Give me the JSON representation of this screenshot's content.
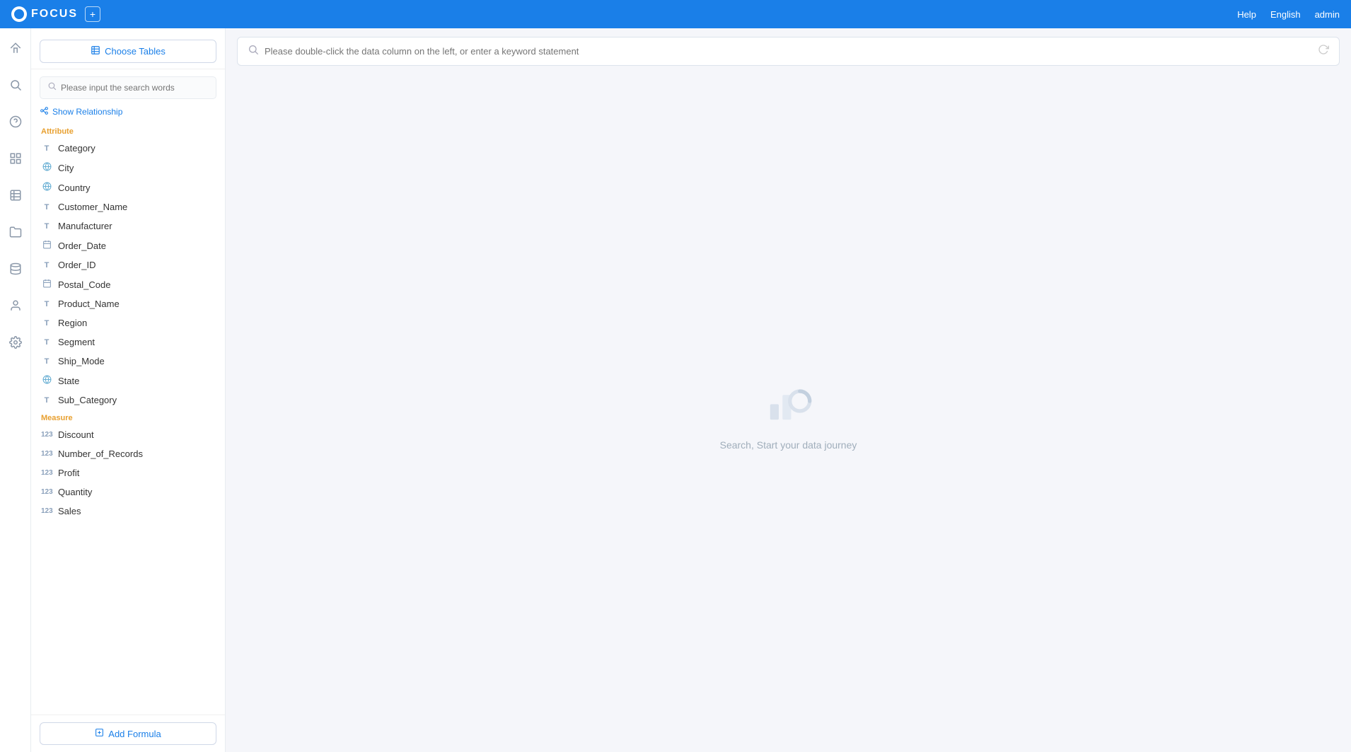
{
  "topnav": {
    "logo_text": "FOCUS",
    "help_label": "Help",
    "language_label": "English",
    "user_label": "admin"
  },
  "sidebar": {
    "choose_tables_label": "Choose Tables",
    "search_placeholder": "Please input the search words",
    "show_relationship_label": "Show Relationship",
    "attribute_section_label": "Attribute",
    "measure_section_label": "Measure",
    "add_formula_label": "Add Formula",
    "attribute_fields": [
      {
        "name": "Category",
        "type": "text"
      },
      {
        "name": "City",
        "type": "geo"
      },
      {
        "name": "Country",
        "type": "geo"
      },
      {
        "name": "Customer_Name",
        "type": "text"
      },
      {
        "name": "Manufacturer",
        "type": "text"
      },
      {
        "name": "Order_Date",
        "type": "date"
      },
      {
        "name": "Order_ID",
        "type": "text"
      },
      {
        "name": "Postal_Code",
        "type": "date"
      },
      {
        "name": "Product_Name",
        "type": "text"
      },
      {
        "name": "Region",
        "type": "text"
      },
      {
        "name": "Segment",
        "type": "text"
      },
      {
        "name": "Ship_Mode",
        "type": "text"
      },
      {
        "name": "State",
        "type": "geo"
      },
      {
        "name": "Sub_Category",
        "type": "text"
      }
    ],
    "measure_fields": [
      {
        "name": "Discount",
        "type": "num"
      },
      {
        "name": "Number_of_Records",
        "type": "num"
      },
      {
        "name": "Profit",
        "type": "num"
      },
      {
        "name": "Quantity",
        "type": "num"
      },
      {
        "name": "Sales",
        "type": "num"
      }
    ]
  },
  "main": {
    "search_placeholder": "Please double-click the data column on the left, or enter a keyword statement",
    "empty_text": "Search, Start your data journey"
  },
  "icon_bar": {
    "icons": [
      {
        "name": "home-icon",
        "symbol": "⌂"
      },
      {
        "name": "search-icon",
        "symbol": "🔍"
      },
      {
        "name": "help-icon",
        "symbol": "?"
      },
      {
        "name": "report-icon",
        "symbol": "📊"
      },
      {
        "name": "table-icon",
        "symbol": "⊞"
      },
      {
        "name": "folder-icon",
        "symbol": "📁"
      },
      {
        "name": "data-icon",
        "symbol": "⊟"
      },
      {
        "name": "user-icon",
        "symbol": "👤"
      },
      {
        "name": "settings-icon",
        "symbol": "⚙"
      }
    ]
  }
}
